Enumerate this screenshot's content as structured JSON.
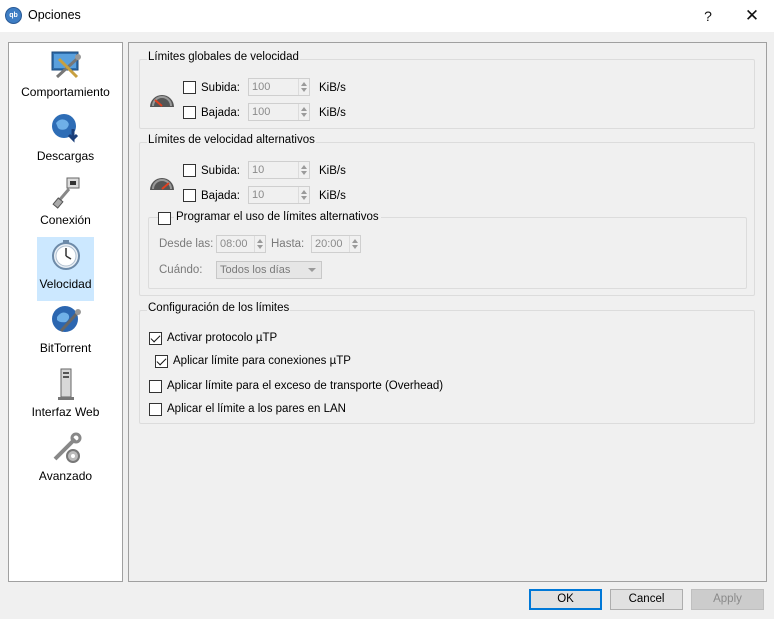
{
  "window": {
    "title": "Opciones",
    "help_glyph": "?",
    "close_glyph": "✕"
  },
  "sidebar": {
    "items": [
      {
        "label": "Comportamiento",
        "icon": "behavior-icon"
      },
      {
        "label": "Descargas",
        "icon": "downloads-icon"
      },
      {
        "label": "Conexión",
        "icon": "connection-icon"
      },
      {
        "label": "Velocidad",
        "icon": "speed-icon",
        "selected": true
      },
      {
        "label": "BitTorrent",
        "icon": "bittorrent-icon"
      },
      {
        "label": "Interfaz Web",
        "icon": "webui-icon"
      },
      {
        "label": "Avanzado",
        "icon": "advanced-icon"
      }
    ]
  },
  "global_limits": {
    "title": "Límites globales de velocidad",
    "upload": {
      "label": "Subida:",
      "value": "100",
      "unit": "KiB/s",
      "checked": false
    },
    "download": {
      "label": "Bajada:",
      "value": "100",
      "unit": "KiB/s",
      "checked": false
    }
  },
  "alt_limits": {
    "title": "Límites de velocidad alternativos",
    "upload": {
      "label": "Subida:",
      "value": "10",
      "unit": "KiB/s",
      "checked": false
    },
    "download": {
      "label": "Bajada:",
      "value": "10",
      "unit": "KiB/s",
      "checked": false
    },
    "schedule": {
      "label": "Programar el uso de límites alternativos",
      "checked": false,
      "from_label": "Desde las:",
      "from_value": "08:00",
      "to_label": "Hasta:",
      "to_value": "20:00",
      "when_label": "Cuándo:",
      "when_value": "Todos los días"
    }
  },
  "config": {
    "title": "Configuración de los límites",
    "utp": {
      "label": "Activar protocolo µTP",
      "checked": true
    },
    "utp_limit": {
      "label": "Aplicar límite para conexiones µTP",
      "checked": true
    },
    "overhead": {
      "label": "Aplicar límite para el exceso de transporte (Overhead)",
      "checked": false
    },
    "lan": {
      "label": "Aplicar el límite a los pares en LAN",
      "checked": false
    }
  },
  "buttons": {
    "ok": "OK",
    "cancel": "Cancel",
    "apply": "Apply"
  },
  "colors": {
    "selection": "#cce8ff",
    "ok_border": "#0078d7"
  }
}
